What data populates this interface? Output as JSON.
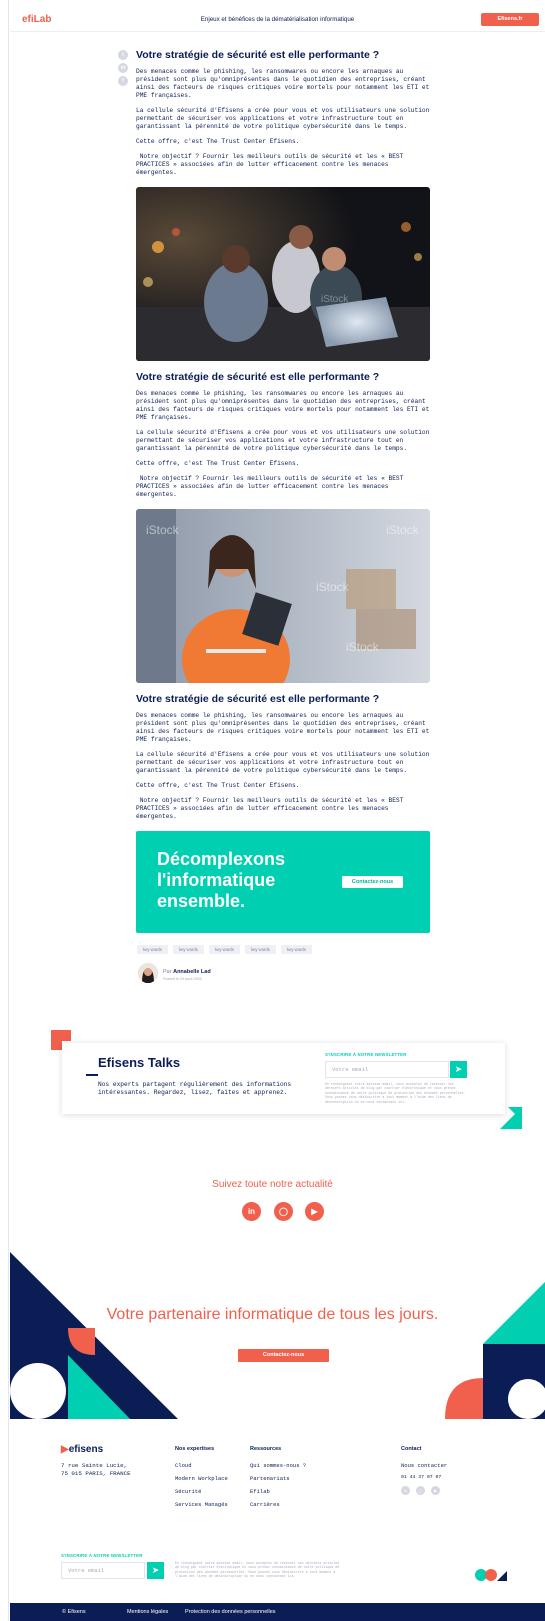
{
  "header": {
    "logo": "efiLab",
    "title": "Enjeux et bénéfices de la dématérialisation informatique",
    "cta": "Efisens.fr"
  },
  "article": {
    "sections": [
      {
        "title": "Votre stratégie de sécurité est elle performante ?",
        "p1": "Des menaces comme le phishing, les ransomwares ou encore les arnaques au président sont plus qu'omniprésentes dans le quotidien des entreprises, créant ainsi des facteurs de risques critiques voire mortels pour notamment les ETI et PME françaises.",
        "p2": "La cellule sécurité d'Efisens a crée pour vous et vos utilisateurs une solution permettant de sécuriser vos applications et votre infrastructure tout en garantissant la pérennité de votre politique cybersécurité dans le temps.",
        "p3": "Cette offre, c'est The Trust Center Efisens.",
        "p4": " Notre objectif ? Fournir les meilleurs outils de sécurité et les « BEST PRACTICES » associées afin de lutter efficacement contre les menaces émergentes."
      },
      {
        "title": "Votre stratégie de sécurité est elle performante ?",
        "p1": "Des menaces comme le phishing, les ransomwares ou encore les arnaques au président sont plus qu'omniprésentes dans le quotidien des entreprises, créant ainsi des facteurs de risques critiques voire mortels pour notamment les ETI et PME françaises.",
        "p2": "La cellule sécurité d'Efisens a crée pour vous et vos utilisateurs une solution permettant de sécuriser vos applications et votre infrastructure tout en garantissant la pérennité de votre politique cybersécurité dans le temps.",
        "p3": "Cette offre, c'est The Trust Center Efisens.",
        "p4": " Notre objectif ? Fournir les meilleurs outils de sécurité et les « BEST PRACTICES » associées afin de lutter efficacement contre les menaces émergentes."
      },
      {
        "title": "Votre stratégie de sécurité est elle performante ?",
        "p1": "Des menaces comme le phishing, les ransomwares ou encore les arnaques au président sont plus qu'omniprésentes dans le quotidien des entreprises, créant ainsi des facteurs de risques critiques voire mortels pour notamment les ETI et PME françaises.",
        "p2": "La cellule sécurité d'Efisens a crée pour vous et vos utilisateurs une solution permettant de sécuriser vos applications et votre infrastructure tout en garantissant la pérennité de votre politique cybersécurité dans le temps.",
        "p3": "Cette offre, c'est The Trust Center Efisens.",
        "p4": " Notre objectif ? Fournir les meilleurs outils de sécurité et les « BEST PRACTICES » associées afin de lutter efficacement contre les menaces émergentes."
      }
    ],
    "share_icons": [
      "twitter-icon",
      "linkedin-icon",
      "facebook-icon"
    ],
    "watermark": "iStock"
  },
  "cta_banner": {
    "text": "Décomplexons l'informatique ensemble.",
    "button": "Contactez-nous"
  },
  "tags": [
    "key words",
    "key words",
    "key words",
    "key words",
    "key words"
  ],
  "author": {
    "prefix": "Par",
    "name": "Annabelle Lad",
    "date": "Posted le 20 août 2020"
  },
  "talks": {
    "title": "Efisens Talks",
    "text": "Nos experts partagent régulièrement des informations intéressantes. Regardez, lisez, faites et apprenez.",
    "newsletter_label": "S'INSCRIRE À NOTRE NEWSLETTER",
    "email_placeholder": "Votre email",
    "disclaimer": "En renseignant votre adresse email, vous acceptez de recevoir nos derniers articles de blog par courrier électronique et vous prenez connaissance de notre politique de protection des données personnelles. Vous pouvez vous désinscrire à tout moment à l'aide des liens de désinscription ou en nous contactant ici."
  },
  "follow": {
    "title": "Suivez toute notre actualité",
    "icons": [
      "linkedin-icon",
      "instagram-icon",
      "youtube-icon"
    ]
  },
  "partner": {
    "title": "Votre partenaire informatique de tous les jours.",
    "button": "Contactez-nous"
  },
  "footer": {
    "logo": "efisens",
    "address": [
      "7 rue Sainte Lucie,",
      "75 015 PARIS, FRANCE"
    ],
    "col1": {
      "title": "Nos expertises",
      "items": [
        "Cloud",
        "Modern Workplace",
        "Sécurité",
        "Services Managés"
      ]
    },
    "col2": {
      "title": "Ressources",
      "items": [
        "Qui sommes-nous ?",
        "Partenariats",
        "Efilab",
        "Carrières"
      ]
    },
    "col3": {
      "title": "Contact",
      "items": [
        "Nous contacter",
        "01 44 37 07 07"
      ]
    },
    "newsletter_label": "S'INSCRIRE À NOTRE NEWSLETTER",
    "email_placeholder": "Votre email",
    "disclaimer": "En renseignant votre adresse email, vous acceptez de recevoir nos derniers articles de blog par courrier électronique et vous prenez connaissance de notre politique de protection des données personnelles. Vous pouvez vous désinscrire à tout moment à l'aide des liens de désinscription ou en nous contactant ici.",
    "copyright": "© Efisens",
    "legal": "Mentions légales",
    "privacy": "Protection des données personnelles"
  },
  "colors": {
    "navy": "#0b1d55",
    "coral": "#f0604d",
    "teal": "#00cfb1"
  }
}
